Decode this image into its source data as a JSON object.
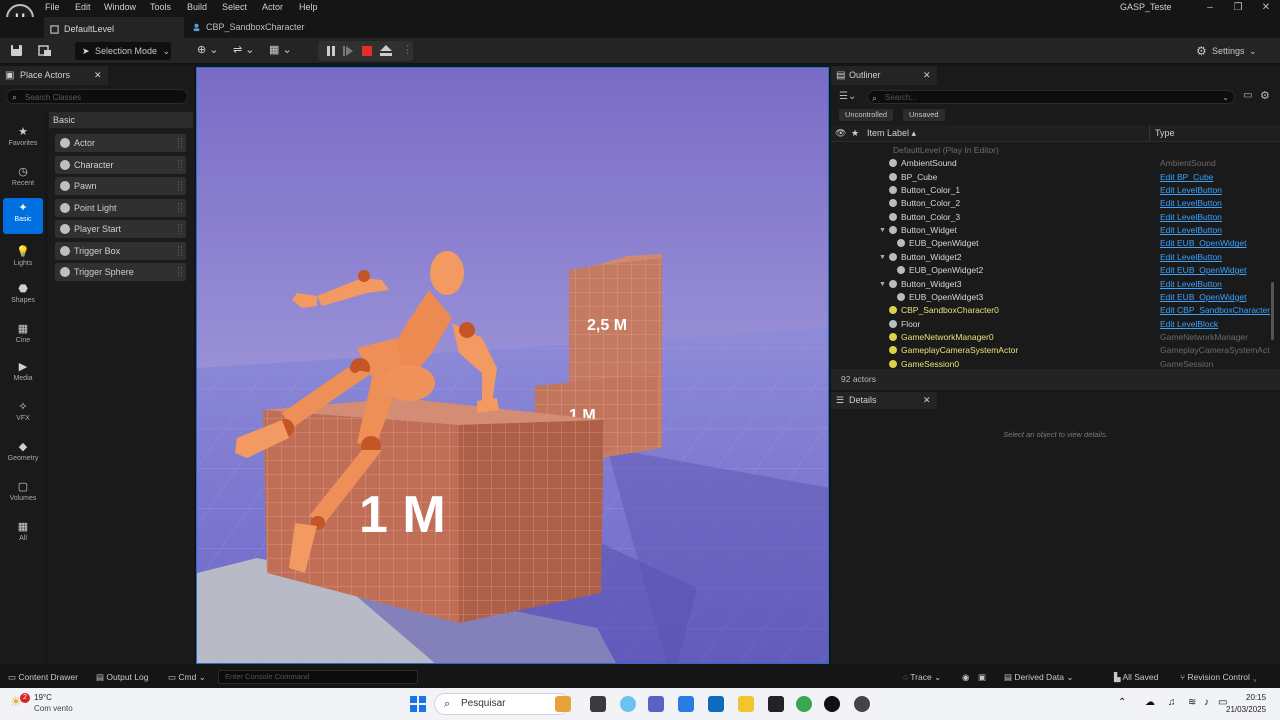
{
  "menubar": {
    "logo": "U",
    "items": [
      "File",
      "Edit",
      "Window",
      "Tools",
      "Build",
      "Select",
      "Actor",
      "Help"
    ],
    "project_title": "GASP_Teste"
  },
  "tabs": [
    {
      "label": "DefaultLevel"
    },
    {
      "label": "CBP_SandboxCharacter"
    }
  ],
  "toolbar": {
    "selection_mode": "Selection Mode",
    "settings": "Settings"
  },
  "place_actors": {
    "tab_label": "Place Actors",
    "search_placeholder": "Search Classes",
    "categories": [
      {
        "label": "Favorites",
        "icon": "star-icon"
      },
      {
        "label": "Recent",
        "icon": "clock-icon"
      },
      {
        "label": "Basic",
        "icon": "basic-icon",
        "active": true
      },
      {
        "label": "Lights",
        "icon": "bulb-icon"
      },
      {
        "label": "Shapes",
        "icon": "shapes-icon"
      },
      {
        "label": "Cine",
        "icon": "clapper-icon"
      },
      {
        "label": "Media",
        "icon": "media-icon"
      },
      {
        "label": "VFX",
        "icon": "sparkle-icon"
      },
      {
        "label": "Geometry",
        "icon": "geometry-icon"
      },
      {
        "label": "Volumes",
        "icon": "volume-icon"
      },
      {
        "label": "All",
        "icon": "all-icon"
      }
    ],
    "section_title": "Basic",
    "items": [
      "Actor",
      "Character",
      "Pawn",
      "Point Light",
      "Player Start",
      "Trigger Box",
      "Trigger Sphere"
    ]
  },
  "viewport": {
    "label_25m": "2,5 M",
    "label_1m_back": "1 M",
    "label_1m_front": "1 M"
  },
  "outliner": {
    "tab_label": "Outliner",
    "search_placeholder": "Search...",
    "filters": [
      "Uncontrolled",
      "Unsaved"
    ],
    "col_label": "Item Label",
    "col_type": "Type",
    "rows": [
      {
        "name": "DefaultLevel (Play In Editor)",
        "type": "",
        "indent": 0,
        "link": false,
        "dim": true
      },
      {
        "name": "AmbientSound",
        "type": "AmbientSound",
        "indent": 1,
        "link": false
      },
      {
        "name": "BP_Cube",
        "type": "Edit BP_Cube",
        "indent": 1,
        "link": true
      },
      {
        "name": "Button_Color_1",
        "type": "Edit LevelButton",
        "indent": 1,
        "link": true
      },
      {
        "name": "Button_Color_2",
        "type": "Edit LevelButton",
        "indent": 1,
        "link": true
      },
      {
        "name": "Button_Color_3",
        "type": "Edit LevelButton",
        "indent": 1,
        "link": true
      },
      {
        "name": "Button_Widget",
        "type": "Edit LevelButton",
        "indent": 1,
        "link": true,
        "expand": true
      },
      {
        "name": "EUB_OpenWidget",
        "type": "Edit EUB_OpenWidget",
        "indent": 2,
        "link": true
      },
      {
        "name": "Button_Widget2",
        "type": "Edit LevelButton",
        "indent": 1,
        "link": true,
        "expand": true
      },
      {
        "name": "EUB_OpenWidget2",
        "type": "Edit EUB_OpenWidget",
        "indent": 2,
        "link": true
      },
      {
        "name": "Button_Widget3",
        "type": "Edit LevelButton",
        "indent": 1,
        "link": true,
        "expand": true
      },
      {
        "name": "EUB_OpenWidget3",
        "type": "Edit EUB_OpenWidget",
        "indent": 2,
        "link": true
      },
      {
        "name": "CBP_SandboxCharacter0",
        "type": "Edit CBP_SandboxCharacter",
        "indent": 1,
        "link": true,
        "highlight": true
      },
      {
        "name": "Floor",
        "type": "Edit LevelBlock",
        "indent": 1,
        "link": true
      },
      {
        "name": "GameNetworkManager0",
        "type": "GameNetworkManager",
        "indent": 1,
        "link": false,
        "highlight": true
      },
      {
        "name": "GameplayCameraSystemActor",
        "type": "GameplayCameraSystemAct",
        "indent": 1,
        "link": false,
        "highlight": true
      },
      {
        "name": "GameSession0",
        "type": "GameSession",
        "indent": 1,
        "link": false,
        "highlight": true
      }
    ],
    "actor_count": "92 actors"
  },
  "details": {
    "tab_label": "Details",
    "empty_text": "Select an object to view details."
  },
  "bottombar": {
    "content_drawer": "Content Drawer",
    "output_log": "Output Log",
    "cmd": "Cmd",
    "console_placeholder": "Enter Console Command",
    "trace": "Trace",
    "derived_data": "Derived Data",
    "all_saved": "All Saved",
    "revision_control": "Revision Control"
  },
  "taskbar": {
    "temperature": "19°C",
    "weather": "Com vento",
    "weather_badge": "2",
    "search": "Pesquisar",
    "time": "20:15",
    "date": "21/03/2025"
  }
}
